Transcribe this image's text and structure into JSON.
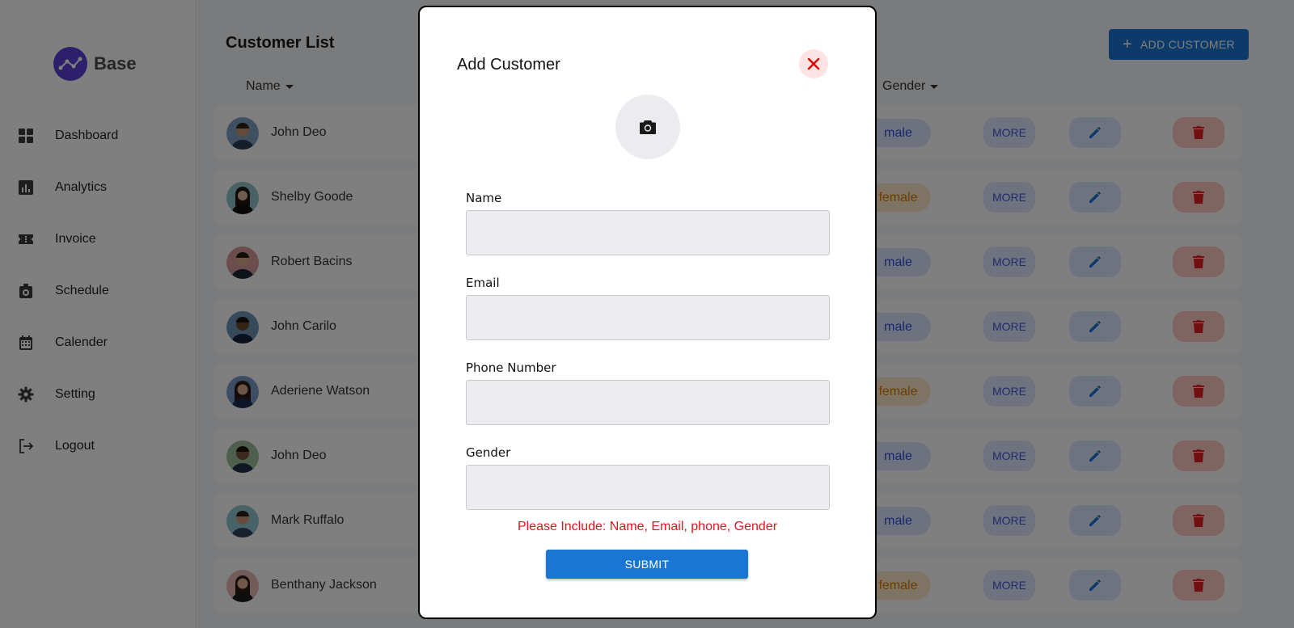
{
  "brand": {
    "name": "Base"
  },
  "sidebar": {
    "items": [
      {
        "label": "Dashboard",
        "icon": "dashboard-icon"
      },
      {
        "label": "Analytics",
        "icon": "analytics-icon"
      },
      {
        "label": "Invoice",
        "icon": "invoice-icon"
      },
      {
        "label": "Schedule",
        "icon": "schedule-icon"
      },
      {
        "label": "Calender",
        "icon": "calendar-icon"
      },
      {
        "label": "Setting",
        "icon": "gear-icon"
      },
      {
        "label": "Logout",
        "icon": "logout-icon"
      }
    ]
  },
  "main": {
    "title": "Customer List",
    "add_button": "ADD CUSTOMER",
    "columns": {
      "name": "Name",
      "gender": "Gender"
    },
    "more_label": "MORE",
    "customers": [
      {
        "name": "John Deo",
        "gender": "male"
      },
      {
        "name": "Shelby Goode",
        "gender": "female"
      },
      {
        "name": "Robert Bacins",
        "gender": "male"
      },
      {
        "name": "John Carilo",
        "gender": "male"
      },
      {
        "name": "Aderiene Watson",
        "gender": "female"
      },
      {
        "name": "John Deo",
        "gender": "male"
      },
      {
        "name": "Mark Ruffalo",
        "gender": "male"
      },
      {
        "name": "Benthany Jackson",
        "gender": "female"
      }
    ]
  },
  "modal": {
    "title": "Add Customer",
    "fields": {
      "name": {
        "label": "Name",
        "value": ""
      },
      "email": {
        "label": "Email",
        "value": ""
      },
      "phone": {
        "label": "Phone Number",
        "value": ""
      },
      "gender": {
        "label": "Gender",
        "value": ""
      }
    },
    "error": "Please Include: Name, Email, phone, Gender",
    "submit": "SUBMIT"
  },
  "colors": {
    "primary": "#1976d2",
    "male_text": "#2b4fd6",
    "female_text": "#d87b00",
    "error": "#e8121f",
    "delete": "#e02020"
  }
}
